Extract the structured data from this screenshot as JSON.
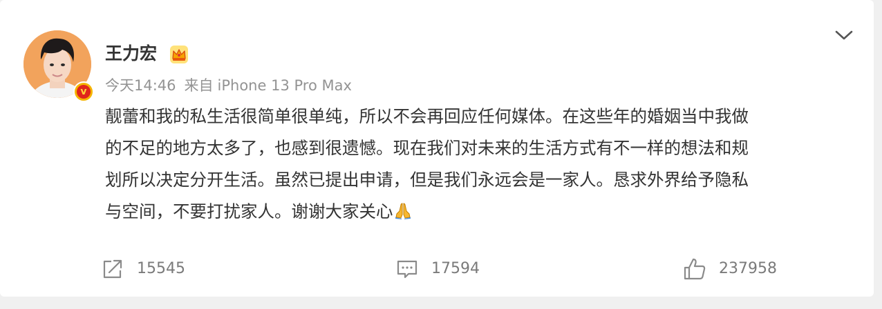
{
  "post": {
    "author": "王力宏",
    "author_badge": "crown-vip-badge-icon",
    "verified_badge_text": "v",
    "time": "今天14:46",
    "source_prefix": "来自",
    "source_device": "iPhone 13 Pro Max",
    "text_lines": [
      "靓蕾和我的私生活很简单很单纯，所以不会再回应任何媒体。在这些年的婚姻当中我做",
      "的不足的地方太多了，也感到很遗憾。现在我们对未来的生活方式有不一样的想法和规",
      "划所以决定分开生活。虽然已提出申请，但是我们永远会是一家人。恳求外界给予隐私",
      "与空间，不要打扰家人。谢谢大家关心"
    ],
    "trailing_emoji": "folded-hands-icon"
  },
  "actions": {
    "share": {
      "icon": "share-icon",
      "count": "15545"
    },
    "comment": {
      "icon": "comment-icon",
      "count": "17594"
    },
    "like": {
      "icon": "thumbs-up-icon",
      "count": "237958"
    }
  },
  "colors": {
    "background": "#f0f0f0",
    "card": "#ffffff",
    "text_primary": "#333333",
    "text_secondary": "#939393",
    "action_icon": "#8a8a8a",
    "verified_badge": "#e0251b",
    "crown": "#f5b400"
  }
}
